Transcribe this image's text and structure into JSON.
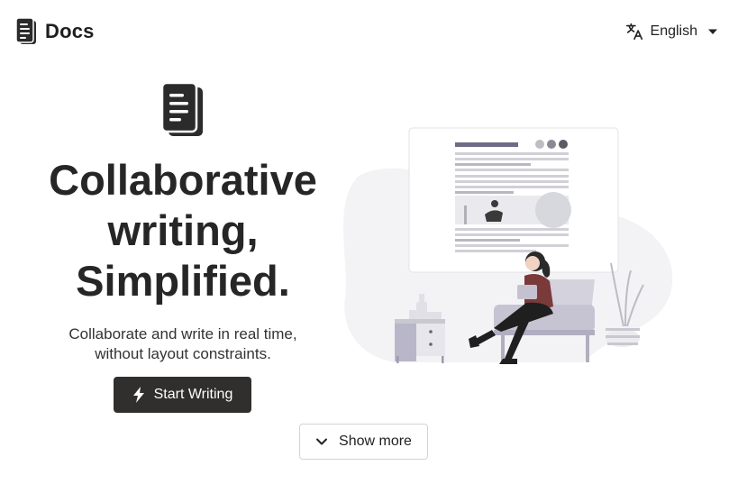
{
  "header": {
    "brand_name": "Docs",
    "brand_icon": "document-icon",
    "language_icon": "translate-icon",
    "language_label": "English",
    "language_caret": "caret-down-icon"
  },
  "hero": {
    "icon": "document-icon",
    "title_line1": "Collaborative",
    "title_line2": "writing,",
    "title_line3": "Simplified.",
    "subtitle_line1": "Collaborate and write in real time,",
    "subtitle_line2": "without layout constraints.",
    "cta_label": "Start Writing",
    "cta_icon": "lightning-icon",
    "more_label": "Show more",
    "more_icon": "chevron-down-icon",
    "illustration": "woman-writing-illustration"
  },
  "colors": {
    "primary": "#302f2d",
    "text": "#262626",
    "blob": "#f3f3f5",
    "accent_purple": "#6f6a86",
    "accent_maroon": "#7a3a3a"
  }
}
